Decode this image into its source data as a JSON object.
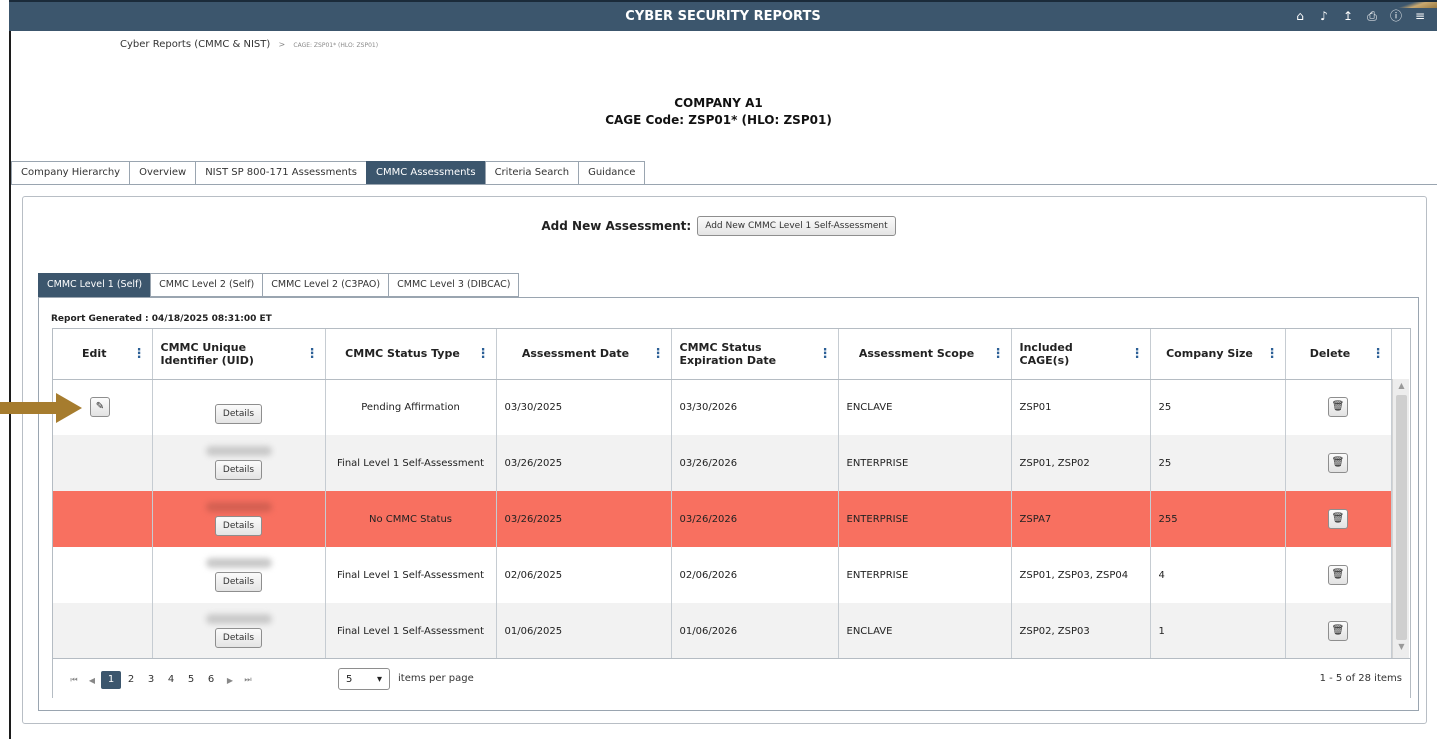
{
  "app": {
    "title": "CYBER SECURITY REPORTS",
    "header_icons": [
      "home-icon",
      "bell-icon",
      "export-icon",
      "print-icon",
      "help-icon",
      "menu-icon"
    ]
  },
  "breadcrumb": {
    "root": "Cyber Reports (CMMC & NIST)",
    "separator": ">",
    "current": "CAGE: ZSP01* (HLO: ZSP01)"
  },
  "company": {
    "name": "COMPANY A1",
    "cage_line": "CAGE Code: ZSP01* (HLO: ZSP01)"
  },
  "tabs": [
    {
      "label": "Company Hierarchy",
      "active": false
    },
    {
      "label": "Overview",
      "active": false
    },
    {
      "label": "NIST SP 800-171 Assessments",
      "active": false
    },
    {
      "label": "CMMC Assessments",
      "active": true
    },
    {
      "label": "Criteria Search",
      "active": false
    },
    {
      "label": "Guidance",
      "active": false
    }
  ],
  "add_assessment": {
    "label": "Add New Assessment:",
    "button": "Add New CMMC Level 1 Self-Assessment"
  },
  "subtabs": [
    {
      "label": "CMMC Level 1 (Self)",
      "active": true
    },
    {
      "label": "CMMC Level 2 (Self)",
      "active": false
    },
    {
      "label": "CMMC Level 2 (C3PAO)",
      "active": false
    },
    {
      "label": "CMMC Level 3 (DIBCAC)",
      "active": false
    }
  ],
  "report_generated": "Report Generated : 04/18/2025 08:31:00 ET",
  "grid": {
    "columns": [
      "Edit",
      "CMMC Unique Identifier (UID)",
      "CMMC Status Type",
      "Assessment Date",
      "CMMC Status Expiration Date",
      "Assessment Scope",
      "Included CAGE(s)",
      "Company Size",
      "Delete"
    ],
    "details_label": "Details",
    "rows": [
      {
        "editable": true,
        "uid_redacted": false,
        "status": "Pending Affirmation",
        "assessment_date": "03/30/2025",
        "expiration": "03/30/2026",
        "scope": "ENCLAVE",
        "cages": "ZSP01",
        "size": "25",
        "highlight": false
      },
      {
        "editable": false,
        "uid_redacted": true,
        "status": "Final Level 1 Self-Assessment",
        "assessment_date": "03/26/2025",
        "expiration": "03/26/2026",
        "scope": "ENTERPRISE",
        "cages": "ZSP01, ZSP02",
        "size": "25",
        "highlight": false
      },
      {
        "editable": false,
        "uid_redacted": true,
        "status": "No CMMC Status",
        "assessment_date": "03/26/2025",
        "expiration": "03/26/2026",
        "scope": "ENTERPRISE",
        "cages": "ZSPA7",
        "size": "255",
        "highlight": true
      },
      {
        "editable": false,
        "uid_redacted": true,
        "status": "Final Level 1 Self-Assessment",
        "assessment_date": "02/06/2025",
        "expiration": "02/06/2026",
        "scope": "ENTERPRISE",
        "cages": "ZSP01, ZSP03, ZSP04",
        "size": "4",
        "highlight": false
      },
      {
        "editable": false,
        "uid_redacted": true,
        "status": "Final Level 1 Self-Assessment",
        "assessment_date": "01/06/2025",
        "expiration": "01/06/2026",
        "scope": "ENCLAVE",
        "cages": "ZSP02, ZSP03",
        "size": "1",
        "highlight": false
      }
    ]
  },
  "pager": {
    "pages": [
      "1",
      "2",
      "3",
      "4",
      "5",
      "6"
    ],
    "current_page": "1",
    "page_size": "5",
    "page_size_label": "items per page",
    "info": "1 - 5 of 28 items"
  },
  "colors": {
    "header_bg": "#3c566d",
    "highlight_row": "#f87060",
    "pointer_arrow": "#a67c2e"
  }
}
